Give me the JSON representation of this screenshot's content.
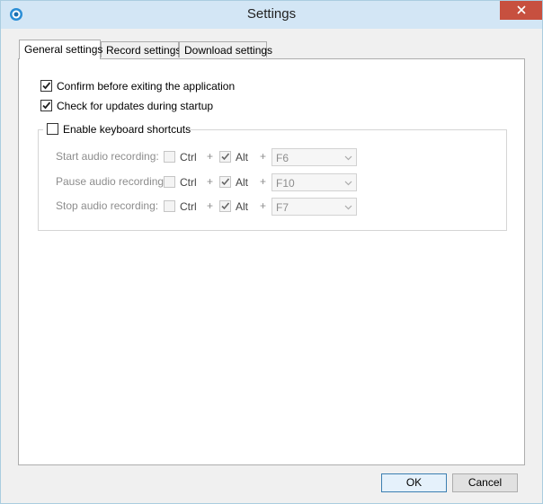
{
  "window": {
    "title": "Settings"
  },
  "tabs": [
    {
      "label": "General settings",
      "active": true
    },
    {
      "label": "Record settings",
      "active": false
    },
    {
      "label": "Download settings",
      "active": false
    }
  ],
  "general": {
    "confirm_exit": {
      "label": "Confirm before exiting the application",
      "checked": true
    },
    "check_updates": {
      "label": "Check for updates during startup",
      "checked": true
    },
    "keyboard_shortcuts": {
      "label": "Enable keyboard shortcuts",
      "checked": false
    }
  },
  "shortcuts": [
    {
      "label": "Start audio recording:",
      "ctrl_label": "Ctrl",
      "ctrl_checked": false,
      "plus1": "+",
      "alt_label": "Alt",
      "alt_checked": true,
      "plus2": "+",
      "key": "F6"
    },
    {
      "label": "Pause audio recording:",
      "ctrl_label": "Ctrl",
      "ctrl_checked": false,
      "plus1": "+",
      "alt_label": "Alt",
      "alt_checked": true,
      "plus2": "+",
      "key": "F10"
    },
    {
      "label": "Stop audio recording:",
      "ctrl_label": "Ctrl",
      "ctrl_checked": false,
      "plus1": "+",
      "alt_label": "Alt",
      "alt_checked": true,
      "plus2": "+",
      "key": "F7"
    }
  ],
  "buttons": {
    "ok": "OK",
    "cancel": "Cancel"
  },
  "icons": {
    "app": "record-disc-icon",
    "close": "close-icon",
    "check": "checkmark-icon",
    "dropdown": "chevron-down-icon"
  },
  "colors": {
    "titlebar": "#d3e6f5",
    "close": "#c7503f",
    "accent": "#3c7fb1"
  }
}
